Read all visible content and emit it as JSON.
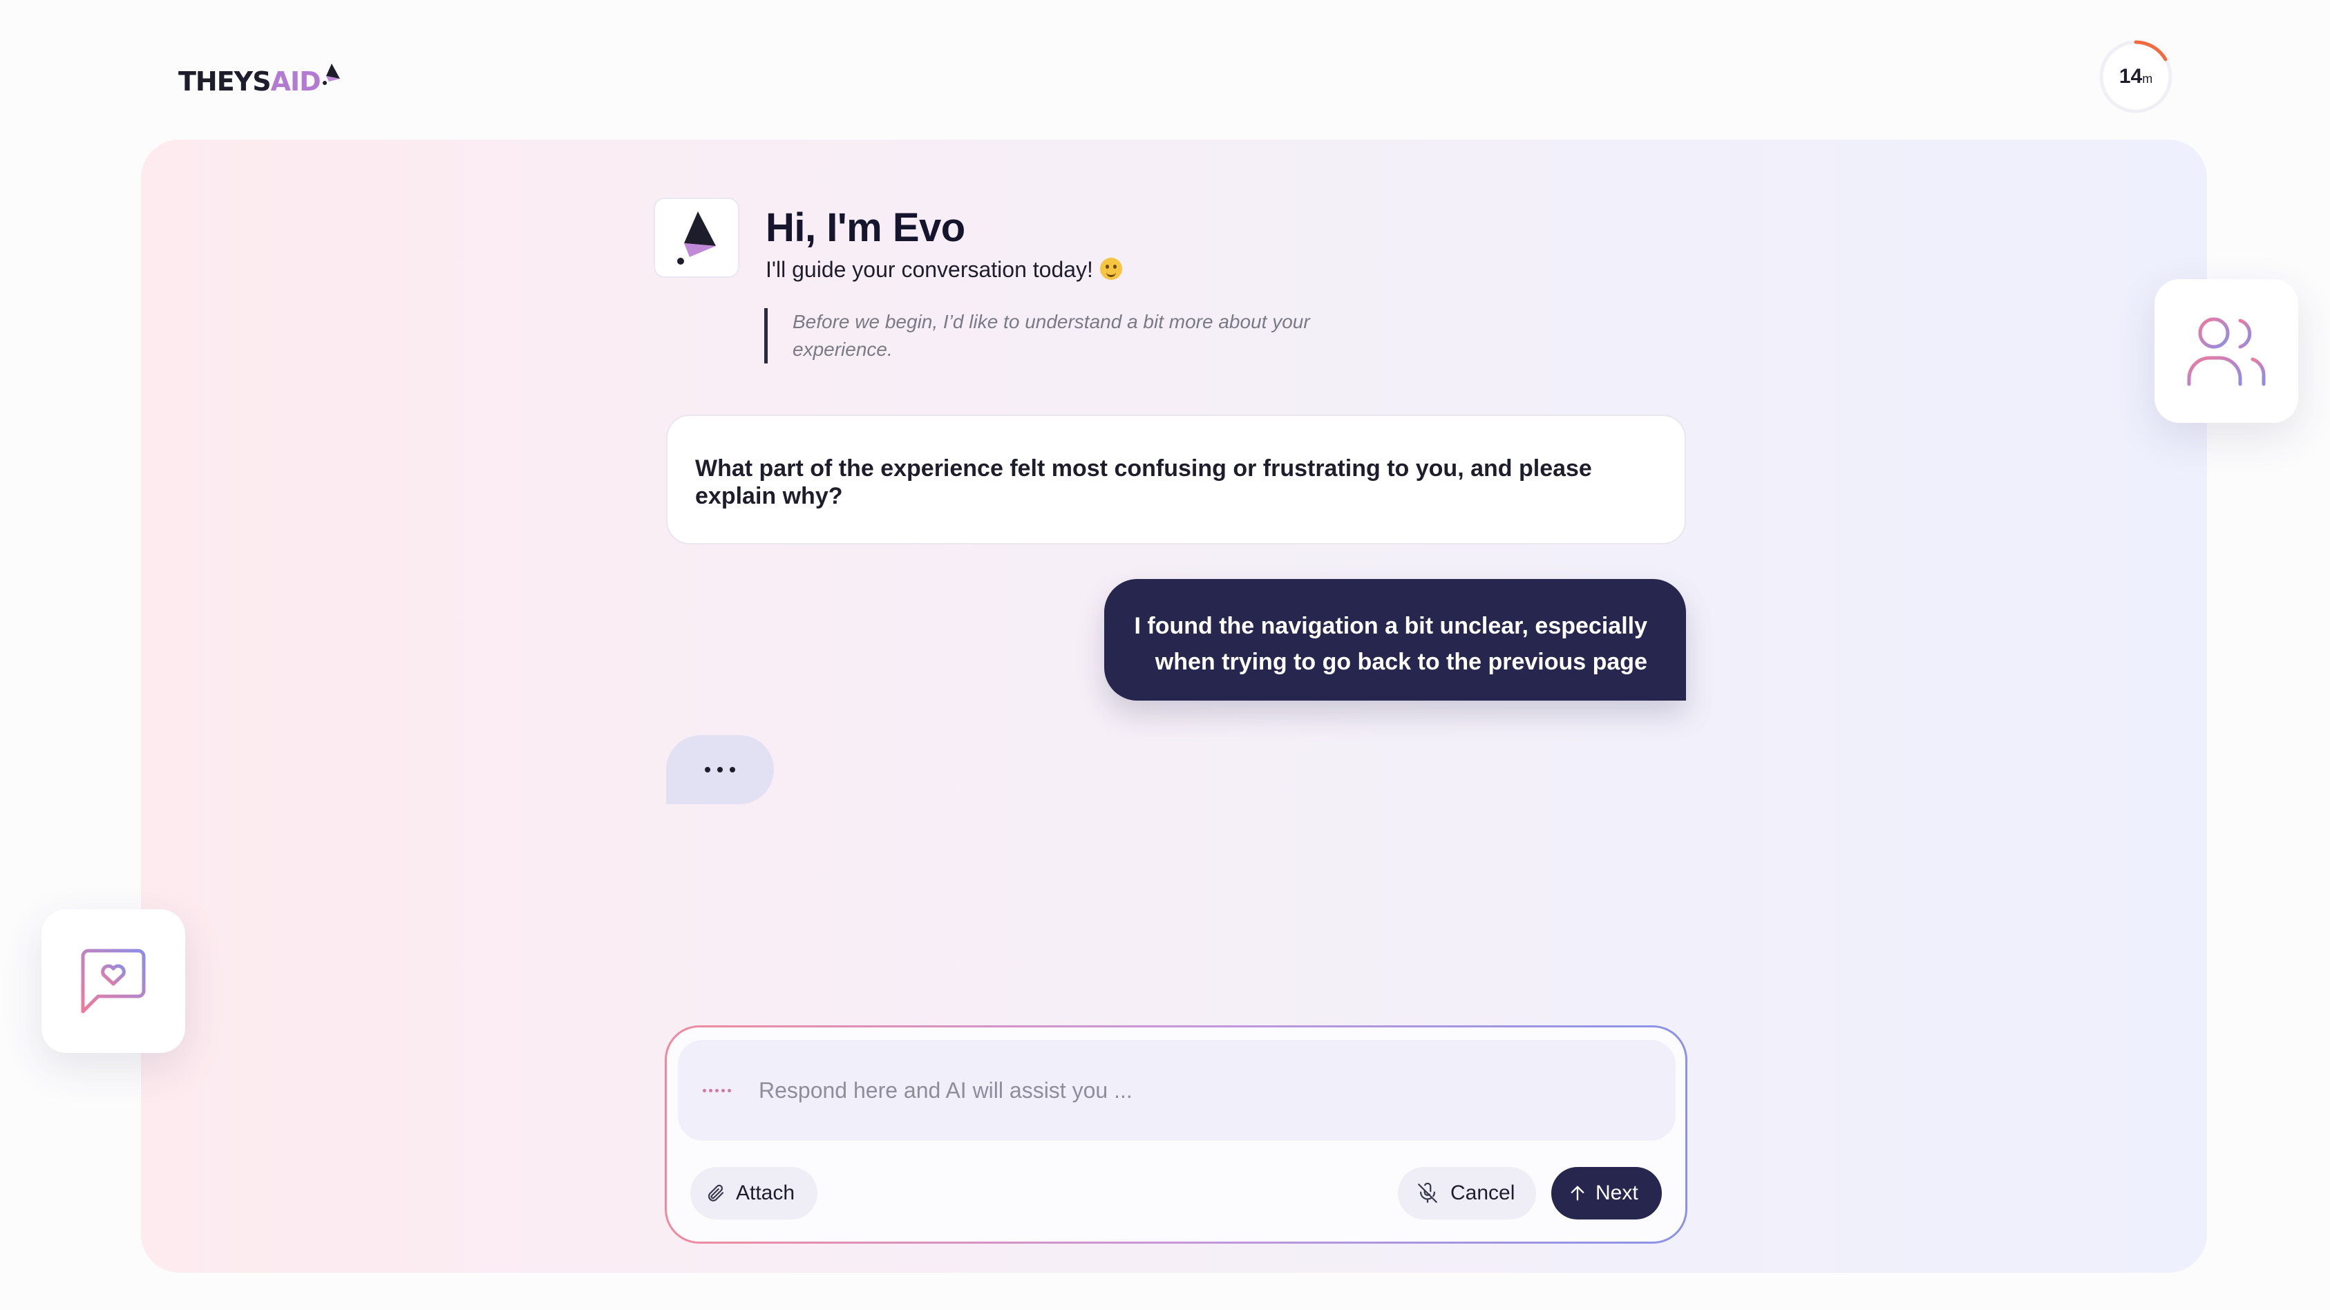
{
  "brand": {
    "logo_text_main": "THEYS",
    "logo_text_accent": "AID",
    "logo_text_end": ""
  },
  "timer": {
    "value": "14",
    "unit": "m",
    "progress": 0.14
  },
  "assistant": {
    "title": "Hi, I'm Evo",
    "subtitle": "I'll guide your conversation today!",
    "intro": "Before we begin, I’d like to understand a bit more about your experience."
  },
  "conversation": {
    "question": "What part of the experience felt most confusing or frustrating to you, and please explain why?",
    "reply": "I found the navigation a bit unclear, especially when trying to go back to the previous page"
  },
  "composer": {
    "placeholder": "Respond here and AI will assist you ...",
    "attach_label": "Attach",
    "cancel_label": "Cancel",
    "next_label": "Next"
  },
  "icons": {
    "avatar": "evo-logo-icon",
    "users": "users-icon",
    "chat": "chat-heart-icon",
    "attach": "paperclip-icon",
    "cancel": "mic-off-icon",
    "next": "arrow-up-icon"
  },
  "colors": {
    "accent_dark": "#26264e",
    "brand_purple": "#b37ad1",
    "timer_orange": "#f26a3d"
  }
}
